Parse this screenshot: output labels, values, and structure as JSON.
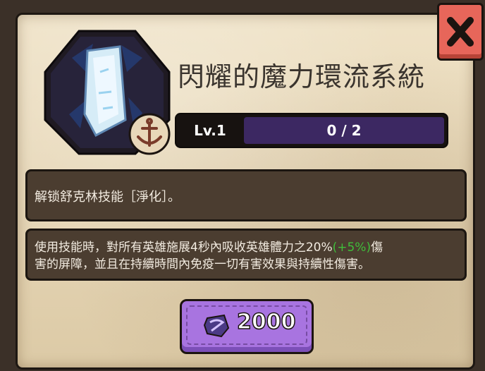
{
  "skill": {
    "title": "閃耀的魔力環流系統",
    "level_label": "Lv.1",
    "progress_text": "0 / 2",
    "progress_fraction": 0.0
  },
  "unlock": {
    "text": "解锁舒克林技能［淨化］。"
  },
  "description": {
    "line1_prefix": "使用技能時，對所有英雄施展4秒內吸收英雄體力之20%",
    "line1_bonus": "(+5%)",
    "line1_suffix": "傷",
    "line2": "害的屏障，並且在持續時間內免疫一切有害效果與持續性傷害。"
  },
  "cost": {
    "value": "2000",
    "icon": "magic-stone-icon"
  },
  "close": {
    "icon": "close-icon"
  },
  "colors": {
    "panel": "#e6d6b6",
    "box": "#4b3d30",
    "button_purple": "#a874e0",
    "close_red": "#e7665a",
    "bonus_green": "#3fbd3a"
  }
}
